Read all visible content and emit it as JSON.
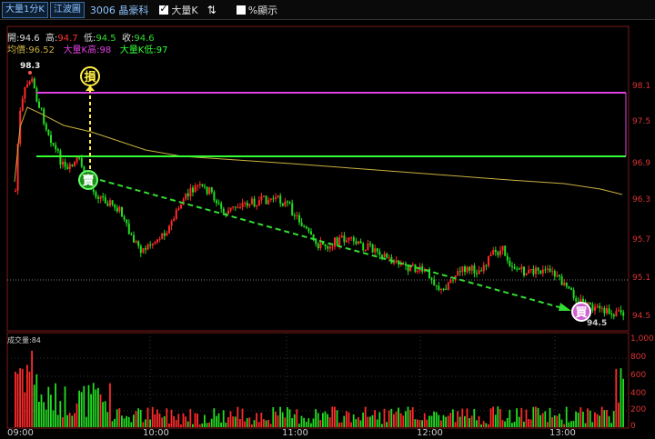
{
  "toolbar": {
    "period_button": "大量1分K",
    "layout_button": "江波圖",
    "stock": "3006 晶豪科",
    "show_volume_k": "大量K",
    "percent_display": "%顯示"
  },
  "header": {
    "open_label": "開:",
    "open_value": "94.6",
    "high_label": "高:",
    "high_value": "94.7",
    "low_label": "低:",
    "low_value": "94.5",
    "close_label": "收:",
    "close_value": "94.6",
    "avg_label": "均價:",
    "avg_value": "96.52",
    "big_high_label": "大量K高:",
    "big_high_value": "98",
    "big_low_label": "大量K低:",
    "big_low_value": "97"
  },
  "price_axis": [
    "98.1",
    "97.5",
    "96.9",
    "96.3",
    "95.7",
    "95.1",
    "94.5"
  ],
  "volume_axis": [
    "1,000",
    "800",
    "600",
    "400",
    "200",
    "0"
  ],
  "time_axis": [
    "09:00",
    "10:00",
    "11:00",
    "12:00",
    "13:00"
  ],
  "volume_label": "成交量:84",
  "annotations": {
    "stop": "損",
    "sell": "賣",
    "buy": "買",
    "peak_price": "98.3",
    "end_price": "94.5"
  },
  "colors": {
    "magenta_line": "#e040e0",
    "green_line": "#33ff33",
    "avg_line": "#c8b040",
    "up": "#ff2a2a",
    "down": "#22dd22",
    "dashed_green": "#33dd33",
    "dashed_yellow": "#ffee44"
  }
}
